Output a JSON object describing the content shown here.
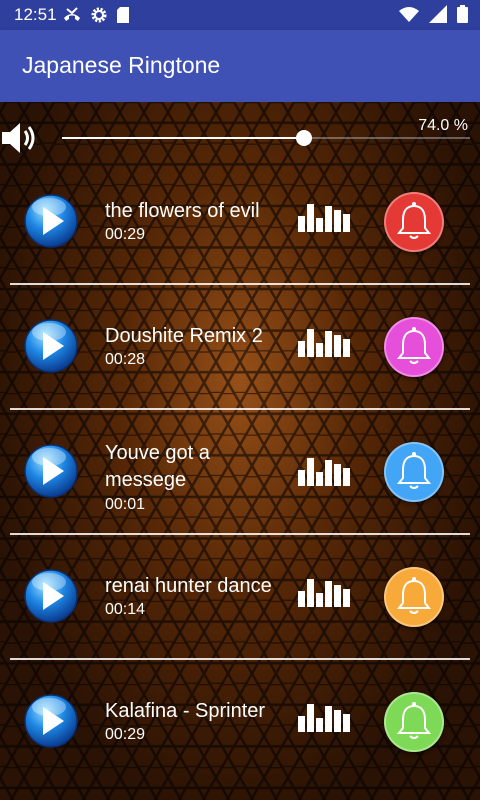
{
  "status_bar": {
    "time": "12:51",
    "icons_left": [
      "missed-call-icon",
      "settings-gear-icon",
      "sd-card-icon"
    ],
    "icons_right": [
      "wifi-icon",
      "signal-icon",
      "battery-icon"
    ]
  },
  "app_bar": {
    "title": "Japanese Ringtone"
  },
  "volume": {
    "percent_text": "74.0 %",
    "level": 0.74
  },
  "ringtones": [
    {
      "title": "the flowers of evil",
      "duration": "00:29",
      "bell_color": "#e53935"
    },
    {
      "title": "Doushite Remix 2",
      "duration": "00:28",
      "bell_color": "#e54fd9"
    },
    {
      "title": "Youve got a messege",
      "duration": "00:01",
      "bell_color": "#42a5f5"
    },
    {
      "title": "renai hunter dance",
      "duration": "00:14",
      "bell_color": "#f7a93a"
    },
    {
      "title": "Kalafina - Sprinter",
      "duration": "00:29",
      "bell_color": "#7ed957"
    }
  ]
}
